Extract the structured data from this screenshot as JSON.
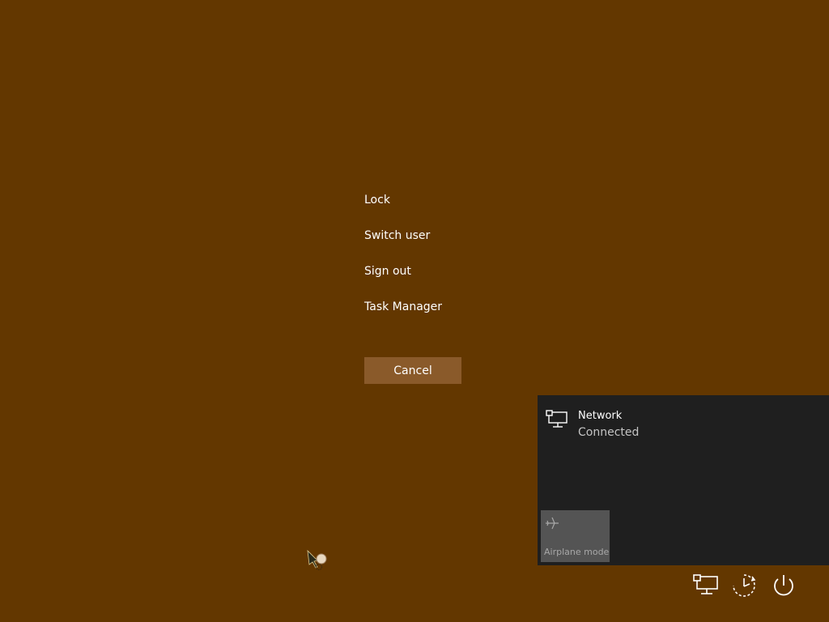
{
  "security_menu": {
    "items": [
      {
        "label": "Lock"
      },
      {
        "label": "Switch user"
      },
      {
        "label": "Sign out"
      },
      {
        "label": "Task Manager"
      }
    ],
    "cancel_label": "Cancel"
  },
  "network_flyout": {
    "network_name": "Network",
    "network_status": "Connected",
    "airplane_mode_label": "Airplane mode"
  },
  "tray": {
    "icons": [
      "network-icon",
      "ease-of-access-icon",
      "power-icon"
    ]
  },
  "colors": {
    "background": "#633700",
    "cancel_button": "#8a5a2a",
    "flyout_background": "#1f1f1f",
    "tile_background": "#545454"
  }
}
